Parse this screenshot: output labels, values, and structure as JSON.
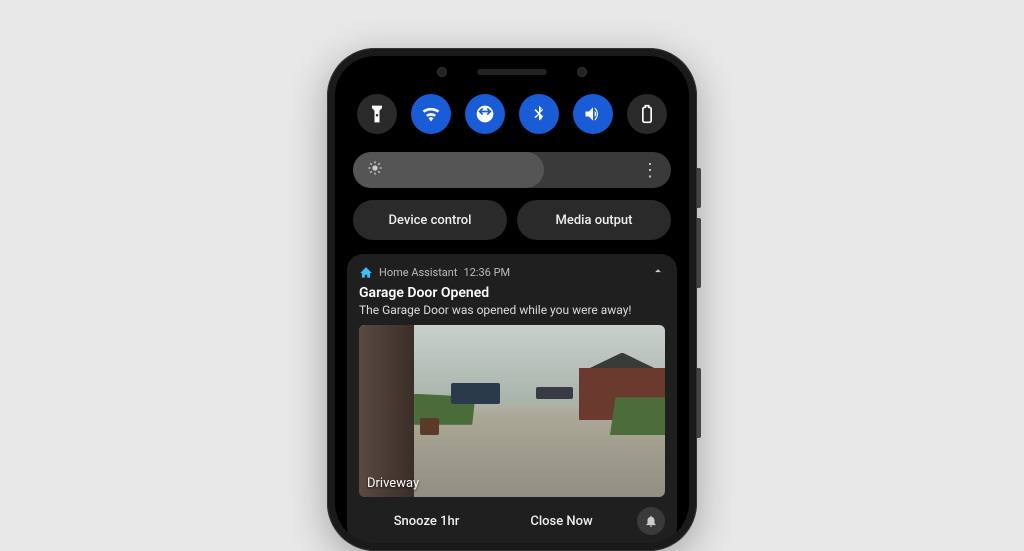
{
  "quick_settings": {
    "toggles": [
      {
        "name": "flashlight",
        "on": false
      },
      {
        "name": "wifi",
        "on": true
      },
      {
        "name": "auto-rotate",
        "on": true
      },
      {
        "name": "bluetooth",
        "on": true
      },
      {
        "name": "sound",
        "on": true
      },
      {
        "name": "battery-saver",
        "on": false
      }
    ],
    "brightness_percent": 60,
    "buttons": {
      "device_control": "Device control",
      "media_output": "Media output"
    }
  },
  "notification": {
    "app_name": "Home Assistant",
    "timestamp": "12:36 PM",
    "title": "Garage Door Opened",
    "body": "The Garage Door was opened while you were away!",
    "camera_label": "Driveway",
    "actions": {
      "snooze": "Snooze 1hr",
      "close": "Close Now"
    }
  },
  "colors": {
    "accent": "#1a5bd6",
    "card": "#1f1f1f"
  }
}
